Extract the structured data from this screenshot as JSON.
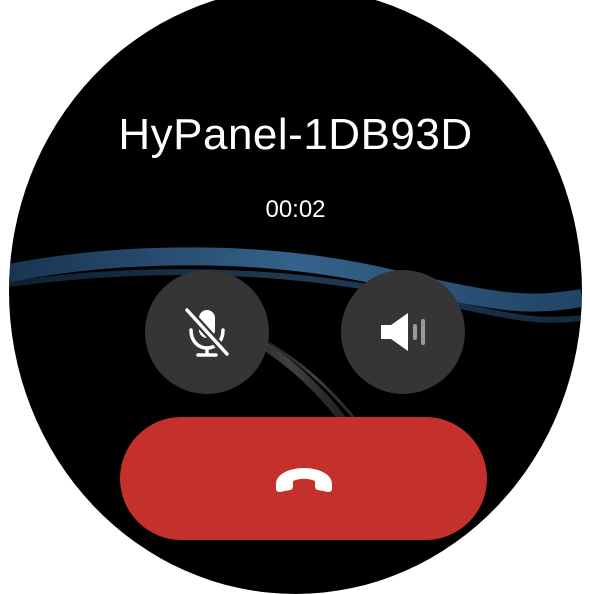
{
  "call": {
    "contact_name": "HyPanel-1DB93D",
    "duration": "00:02",
    "state": "in-call"
  },
  "controls": {
    "mute_icon": "microphone-muted-icon",
    "speaker_icon": "speaker-icon",
    "end_call_icon": "phone-hangup-icon"
  },
  "colors": {
    "background": "#000000",
    "control_button": "#353535",
    "end_call": "#c4302b",
    "text": "#ffffff"
  }
}
